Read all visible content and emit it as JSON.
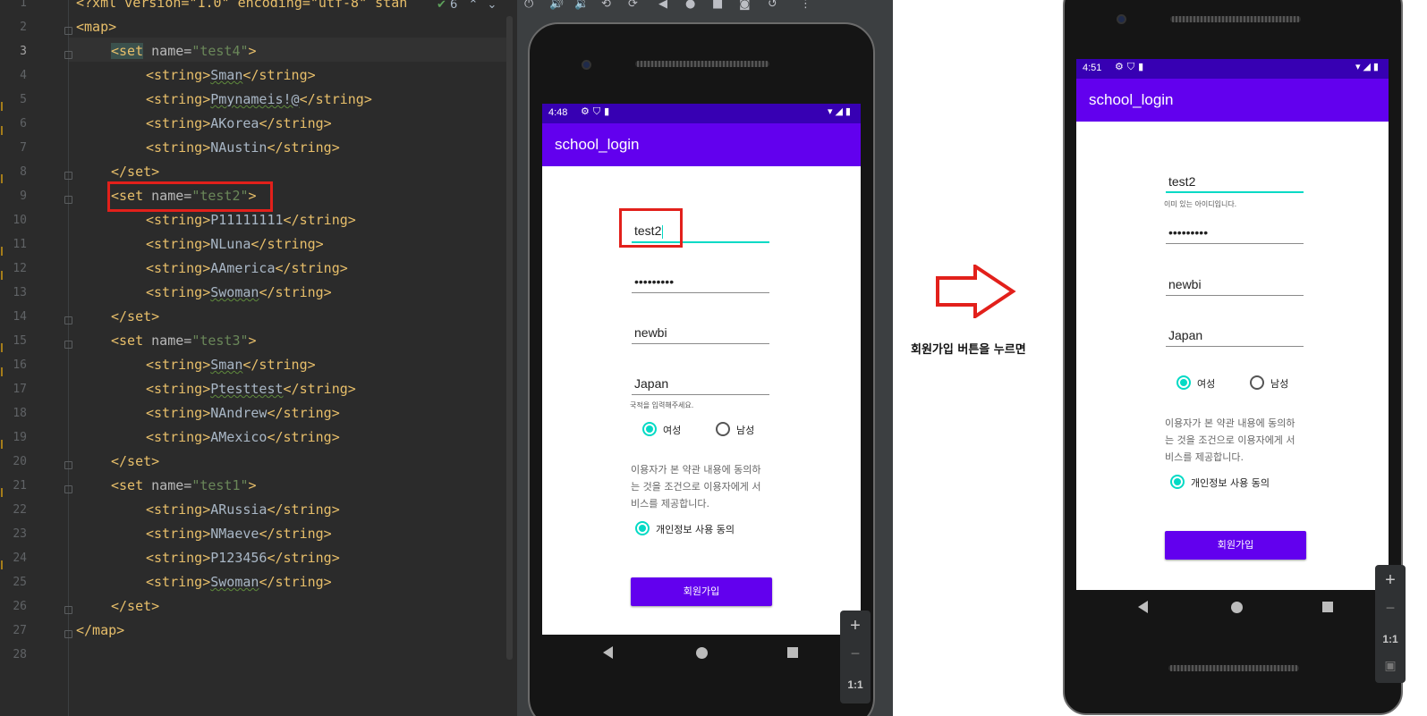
{
  "editor": {
    "inspection_count": "6",
    "lines": [
      {
        "n": "1",
        "text": "<?xml version=\"1.0\" encoding=\"utf-8\" stan"
      },
      {
        "n": "2",
        "text": "<map>"
      },
      {
        "n": "3",
        "tag_open": "<set",
        "attr": " name=",
        "val": "\"test4\"",
        "close": ">"
      },
      {
        "n": "4",
        "open": "<string>",
        "content": "Sman",
        "close": "</string>"
      },
      {
        "n": "5",
        "open": "<string>",
        "content": "Pmynameis!@",
        "close": "</string>"
      },
      {
        "n": "6",
        "open": "<string>",
        "content": "AKorea",
        "close": "</string>"
      },
      {
        "n": "7",
        "open": "<string>",
        "content": "NAustin",
        "close": "</string>"
      },
      {
        "n": "8",
        "text": "</set>"
      },
      {
        "n": "9",
        "tag_open": "<set",
        "attr": " name=",
        "val": "\"test2\"",
        "close": ">"
      },
      {
        "n": "10",
        "open": "<string>",
        "content": "P11111111",
        "close": "</string>"
      },
      {
        "n": "11",
        "open": "<string>",
        "content": "NLuna",
        "close": "</string>"
      },
      {
        "n": "12",
        "open": "<string>",
        "content": "AAmerica",
        "close": "</string>"
      },
      {
        "n": "13",
        "open": "<string>",
        "content": "Swoman",
        "close": "</string>"
      },
      {
        "n": "14",
        "text": "</set>"
      },
      {
        "n": "15",
        "tag_open": "<set",
        "attr": " name=",
        "val": "\"test3\"",
        "close": ">"
      },
      {
        "n": "16",
        "open": "<string>",
        "content": "Sman",
        "close": "</string>"
      },
      {
        "n": "17",
        "open": "<string>",
        "content": "Ptesttest",
        "close": "</string>"
      },
      {
        "n": "18",
        "open": "<string>",
        "content": "NAndrew",
        "close": "</string>"
      },
      {
        "n": "19",
        "open": "<string>",
        "content": "AMexico",
        "close": "</string>"
      },
      {
        "n": "20",
        "text": "</set>"
      },
      {
        "n": "21",
        "tag_open": "<set",
        "attr": " name=",
        "val": "\"test1\"",
        "close": ">"
      },
      {
        "n": "22",
        "open": "<string>",
        "content": "ARussia",
        "close": "</string>"
      },
      {
        "n": "23",
        "open": "<string>",
        "content": "NMaeve",
        "close": "</string>"
      },
      {
        "n": "24",
        "open": "<string>",
        "content": "P123456",
        "close": "</string>"
      },
      {
        "n": "25",
        "open": "<string>",
        "content": "Swoman",
        "close": "</string>"
      },
      {
        "n": "26",
        "text": "</set>"
      },
      {
        "n": "27",
        "text": "</map>"
      },
      {
        "n": "28",
        "text": ""
      }
    ]
  },
  "emulator_before": {
    "status_time": "4:48",
    "app_title": "school_login",
    "id_value": "test2",
    "password_mask": "•••••••••",
    "name_value": "newbi",
    "country_value": "Japan",
    "country_helper": "국적을 입력해주세요.",
    "gender_female": "여성",
    "gender_male": "남성",
    "terms_line1": "이용자가 본 약관 내용에 동의하",
    "terms_line2": "는 것을 조건으로 이용자에게 서",
    "terms_line3": "비스를 제공합니다.",
    "consent_label": "개인정보 사용 동의",
    "signup_button": "회원가입",
    "zoom_plus": "+",
    "zoom_minus": "−",
    "zoom_ratio": "1:1"
  },
  "middle": {
    "caption": "회원가입 버튼을 누르면",
    "arrow_color": "#e2201b"
  },
  "emulator_after": {
    "status_time": "4:51",
    "app_title": "school_login",
    "id_value": "test2",
    "id_helper": "이미 있는 아이디입니다.",
    "password_mask": "•••••••••",
    "name_value": "newbi",
    "country_value": "Japan",
    "gender_female": "여성",
    "gender_male": "남성",
    "terms_line1": "이용자가 본 약관 내용에 동의하",
    "terms_line2": "는 것을 조건으로 이용자에게 서",
    "terms_line3": "비스를 제공합니다.",
    "consent_label": "개인정보 사용 동의",
    "signup_button": "회원가입",
    "zoom_plus": "+",
    "zoom_minus": "−",
    "zoom_ratio": "1:1"
  },
  "colors": {
    "primary": "#6200ee",
    "primary_dark": "#3700b3",
    "accent": "#03dac5",
    "highlight_box": "#e2201b"
  }
}
